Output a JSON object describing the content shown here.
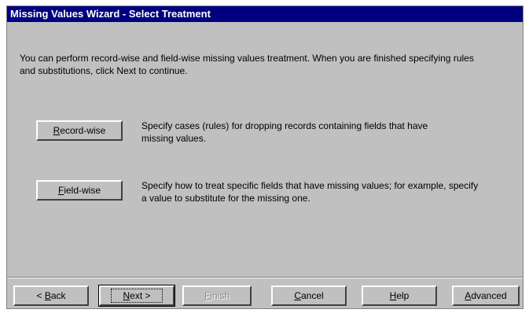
{
  "window": {
    "title": "Missing Values Wizard - Select Treatment"
  },
  "intro_text": "You can perform record-wise and field-wise missing values treatment.  When you are finished specifying rules and substitutions, click Next to continue.",
  "options": {
    "record_wise": {
      "label_accel": "R",
      "label_rest": "ecord-wise",
      "description": "Specify cases (rules) for dropping records containing fields that have missing values."
    },
    "field_wise": {
      "label_accel": "F",
      "label_rest": "ield-wise",
      "description": "Specify how to treat specific fields that have missing values; for example, specify a value to substitute for the missing one."
    }
  },
  "footer": {
    "back": {
      "prefix": "< ",
      "accel": "B",
      "rest": "ack"
    },
    "next": {
      "accel": "N",
      "rest": "ext >"
    },
    "finish": {
      "accel": "F",
      "rest": "inish"
    },
    "cancel": {
      "accel": "C",
      "rest": "ancel"
    },
    "help": {
      "accel": "H",
      "rest": "elp"
    },
    "advanced": {
      "accel": "A",
      "rest": "dvanced"
    }
  }
}
